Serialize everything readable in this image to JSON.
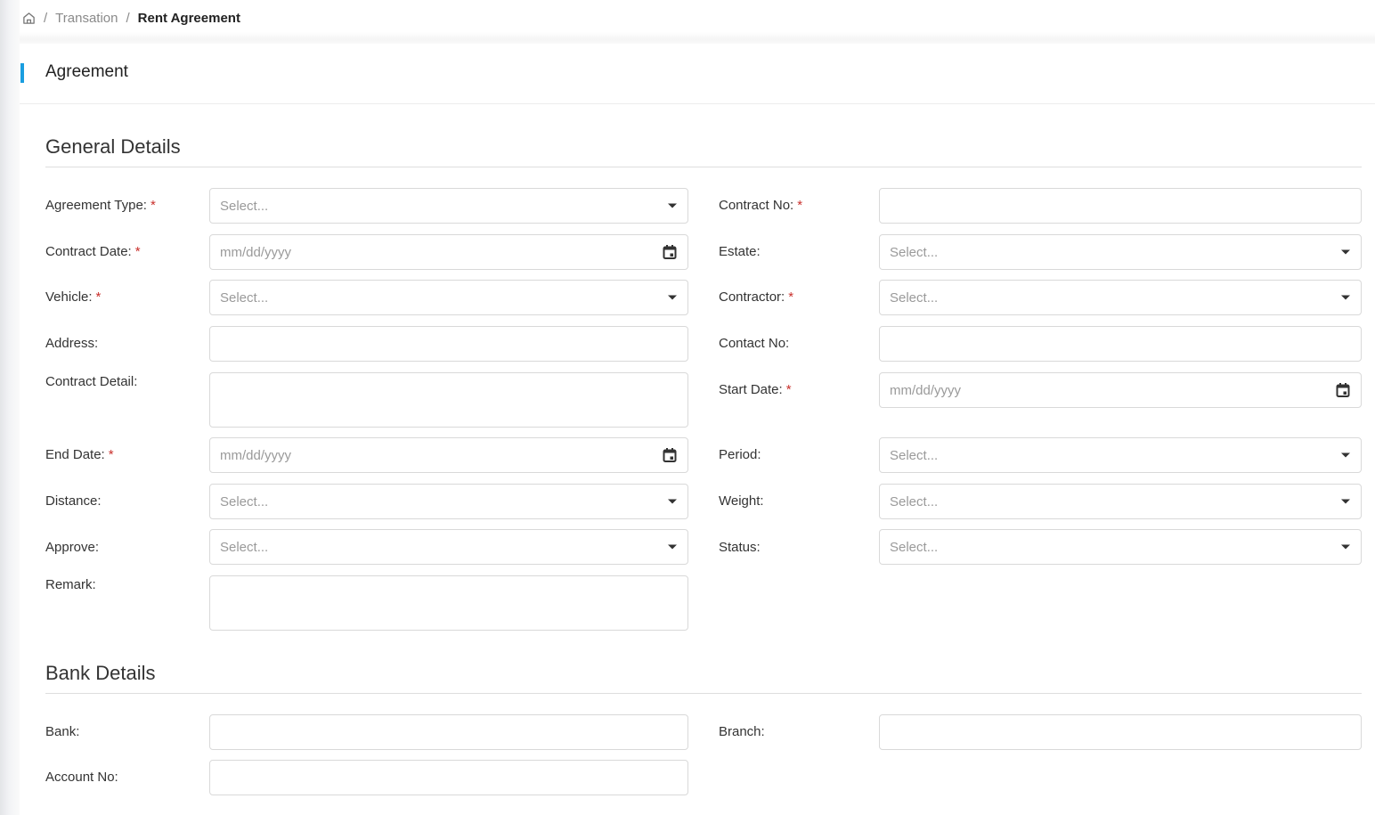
{
  "breadcrumb": {
    "home_icon": "home-icon",
    "separator": "/",
    "items": [
      {
        "label": "Transation"
      },
      {
        "label": "Rent Agreement"
      }
    ]
  },
  "card": {
    "title": "Agreement",
    "accent_color": "#1a9ee0"
  },
  "sections": {
    "general": {
      "title": "General Details",
      "fields": {
        "agreement_type": {
          "label": "Agreement Type:",
          "required": "*",
          "placeholder": "Select...",
          "type": "select"
        },
        "contract_no": {
          "label": "Contract No:",
          "required": "*",
          "value": "",
          "type": "text"
        },
        "contract_date": {
          "label": "Contract Date:",
          "required": "*",
          "placeholder": "mm/dd/yyyy",
          "type": "date"
        },
        "estate": {
          "label": "Estate:",
          "placeholder": "Select...",
          "type": "select"
        },
        "vehicle": {
          "label": "Vehicle:",
          "required": "*",
          "placeholder": "Select...",
          "type": "select"
        },
        "contractor": {
          "label": "Contractor:",
          "required": "*",
          "placeholder": "Select...",
          "type": "select"
        },
        "address": {
          "label": "Address:",
          "value": "",
          "type": "text"
        },
        "contact_no": {
          "label": "Contact No:",
          "value": "",
          "type": "text"
        },
        "contract_detail": {
          "label": "Contract Detail:",
          "value": "",
          "type": "textarea"
        },
        "start_date": {
          "label": "Start Date:",
          "required": "*",
          "placeholder": "mm/dd/yyyy",
          "type": "date"
        },
        "end_date": {
          "label": "End Date:",
          "required": "*",
          "placeholder": "mm/dd/yyyy",
          "type": "date"
        },
        "period": {
          "label": "Period:",
          "placeholder": "Select...",
          "type": "select"
        },
        "distance": {
          "label": "Distance:",
          "placeholder": "Select...",
          "type": "select"
        },
        "weight": {
          "label": "Weight:",
          "placeholder": "Select...",
          "type": "select"
        },
        "approve": {
          "label": "Approve:",
          "placeholder": "Select...",
          "type": "select"
        },
        "status": {
          "label": "Status:",
          "placeholder": "Select...",
          "type": "select"
        },
        "remark": {
          "label": "Remark:",
          "value": "",
          "type": "textarea"
        }
      }
    },
    "bank": {
      "title": "Bank Details",
      "fields": {
        "bank": {
          "label": "Bank:",
          "value": "",
          "type": "text"
        },
        "branch": {
          "label": "Branch:",
          "value": "",
          "type": "text"
        },
        "account_no": {
          "label": "Account No:",
          "value": "",
          "type": "text"
        }
      }
    }
  },
  "icons": {
    "dropdown": "caret-down-icon",
    "date": "calendar-icon"
  }
}
